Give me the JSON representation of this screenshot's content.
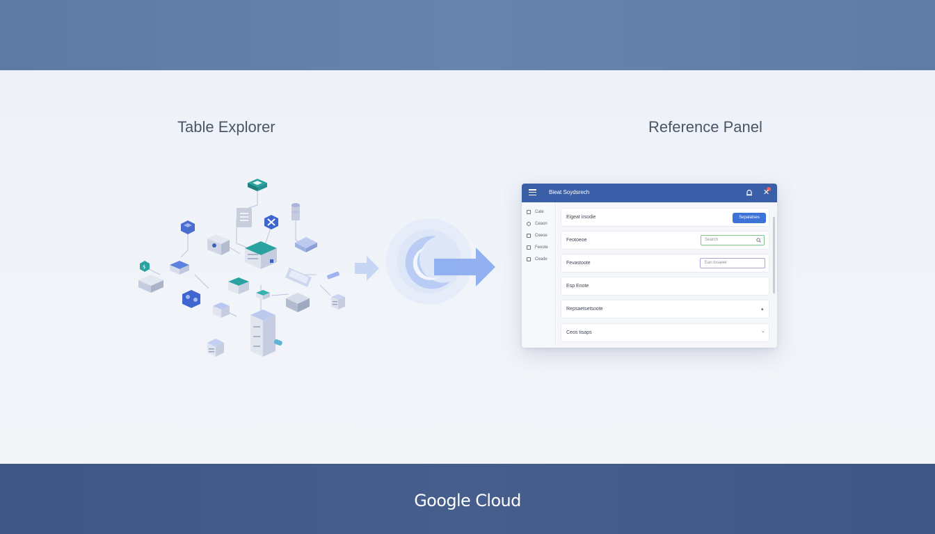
{
  "section_titles": {
    "left": "Table Explorer",
    "right": "Reference Panel"
  },
  "brand": "Google Cloud",
  "panel": {
    "title": "Bieat Soydsrech",
    "sidebar_items": [
      "Cate",
      "Ceaon",
      "Ceeoe",
      "Feoote",
      "Ceade"
    ],
    "rows": [
      {
        "label": "Eigeat irsodie",
        "button": "Sepalatses"
      },
      {
        "label": "Feotoeoe",
        "placeholder": "Search"
      },
      {
        "label": "Fevastoote",
        "placeholder": "Ean losaeer"
      },
      {
        "label": "Esp Enote"
      },
      {
        "label": "Repsaetsetsoote",
        "caret": "▴"
      },
      {
        "label": "Ceos tisaps",
        "caret": "⌄"
      }
    ]
  },
  "colors": {
    "top_band": "#6784ad",
    "bottom_band": "#465e8d",
    "panel_header": "#3b5ea8",
    "primary_button": "#3d72d8",
    "teal_accent": "#2aa3a0"
  }
}
